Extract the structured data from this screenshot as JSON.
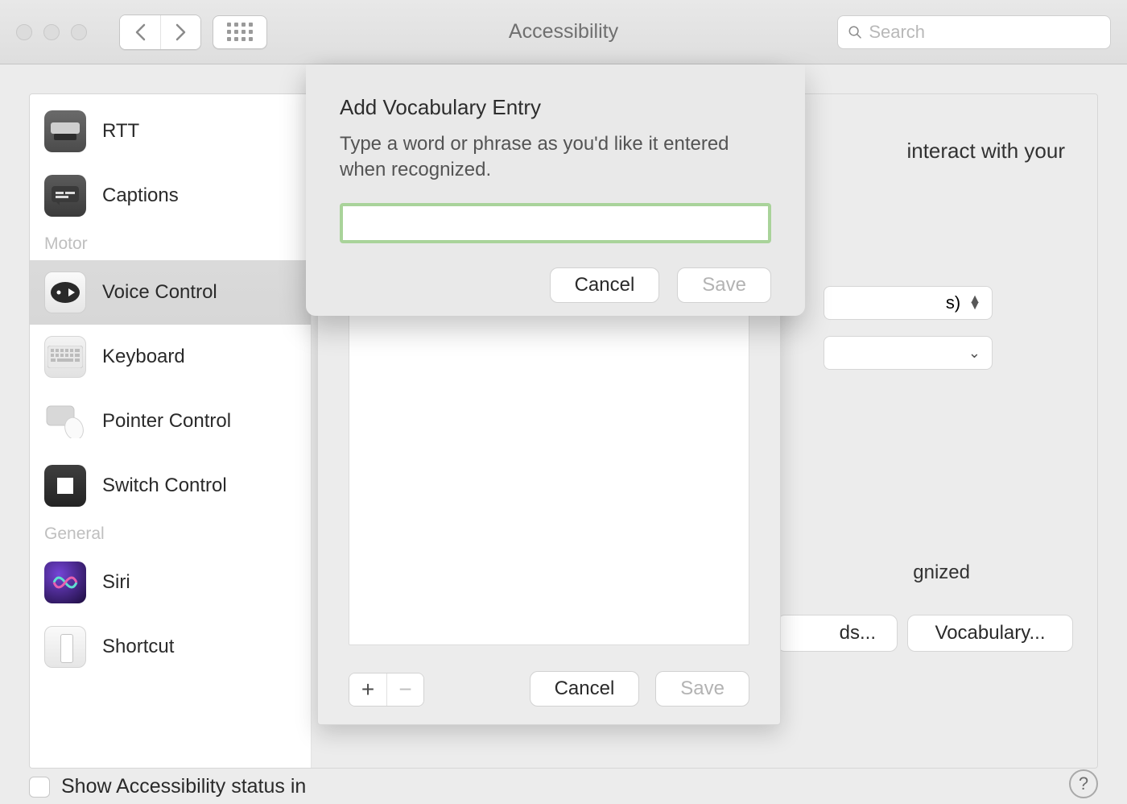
{
  "window": {
    "title": "Accessibility",
    "search_placeholder": "Search"
  },
  "sidebar": {
    "sections": [
      {
        "items": [
          {
            "key": "rtt",
            "label": "RTT"
          },
          {
            "key": "captions",
            "label": "Captions"
          }
        ]
      },
      {
        "label": "Motor",
        "items": [
          {
            "key": "voice-control",
            "label": "Voice Control",
            "selected": true
          },
          {
            "key": "keyboard",
            "label": "Keyboard"
          },
          {
            "key": "pointer-control",
            "label": "Pointer Control"
          },
          {
            "key": "switch-control",
            "label": "Switch Control"
          }
        ]
      },
      {
        "label": "General",
        "items": [
          {
            "key": "siri",
            "label": "Siri"
          },
          {
            "key": "shortcut",
            "label": "Shortcut"
          }
        ]
      }
    ]
  },
  "pane": {
    "interact_text": "interact with your",
    "dropdown1_suffix": "s)",
    "recognized_suffix": "gnized",
    "commands_label": "ds...",
    "vocabulary_label": "Vocabulary..."
  },
  "vocab_sheet": {
    "cancel": "Cancel",
    "save": "Save",
    "plus": "+",
    "minus": "−"
  },
  "add_popover": {
    "title": "Add Vocabulary Entry",
    "description": "Type a word or phrase as you'd like it entered when recognized.",
    "input_value": "",
    "cancel": "Cancel",
    "save": "Save"
  },
  "footer": {
    "show_status_label": "Show Accessibility status in",
    "help": "?"
  }
}
